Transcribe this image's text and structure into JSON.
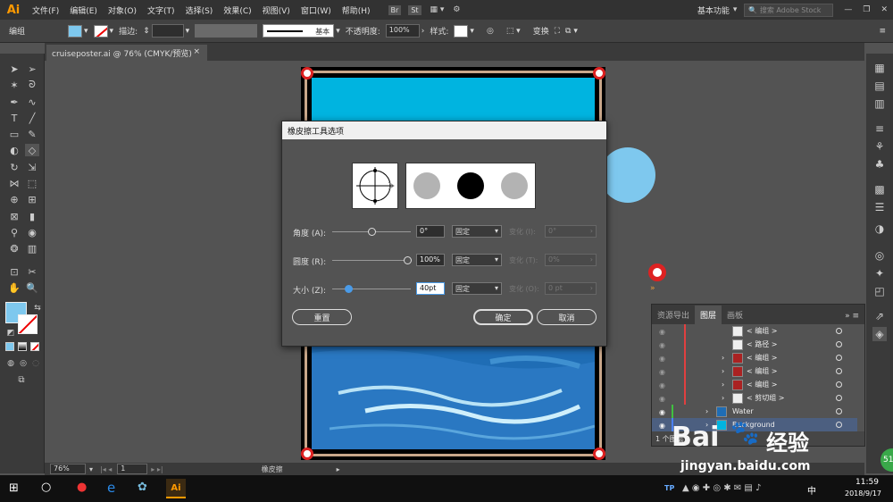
{
  "app": {
    "logo": "Ai"
  },
  "menu": [
    "文件(F)",
    "编辑(E)",
    "对象(O)",
    "文字(T)",
    "选择(S)",
    "效果(C)",
    "视图(V)",
    "窗口(W)",
    "帮助(H)"
  ],
  "menu_right": {
    "br_label": "Br",
    "st_label": "St",
    "workspace": "基本功能",
    "search_placeholder": "搜索 Adobe Stock"
  },
  "control": {
    "selection": "编组",
    "stroke_label": "描边:",
    "stroke_style": "基本",
    "opacity_label": "不透明度:",
    "opacity": "100%",
    "style_label": "样式:",
    "transform_label": "变换"
  },
  "document": {
    "tab_title": "cruiseposter.ai @ 76% (CMYK/预览)",
    "tab_close": "×"
  },
  "status": {
    "zoom": "76%",
    "page": "1",
    "tool": "橡皮擦"
  },
  "dialog": {
    "title": "橡皮擦工具选项",
    "rows": [
      {
        "label": "角度 (A):",
        "value": "0°",
        "mode": "固定",
        "var_label": "变化 (I):",
        "var_value": "0°"
      },
      {
        "label": "圆度 (R):",
        "value": "100%",
        "mode": "固定",
        "var_label": "变化 (T):",
        "var_value": "0%"
      },
      {
        "label": "大小 (Z):",
        "value": "40pt",
        "mode": "固定",
        "var_label": "变化 (O):",
        "var_value": "0 pt"
      }
    ],
    "reset": "重置",
    "ok": "确定",
    "cancel": "取消"
  },
  "layers_panel": {
    "tabs": [
      "资源导出",
      "图层",
      "画板"
    ],
    "active_tab": "图层",
    "rows": [
      {
        "name": "< 编组 >"
      },
      {
        "name": "< 路径 >"
      },
      {
        "name": "< 编组 >"
      },
      {
        "name": "< 编组 >"
      },
      {
        "name": "< 编组 >"
      },
      {
        "name": "< 剪切组 >"
      },
      {
        "name": "Water"
      },
      {
        "name": "Background"
      }
    ],
    "footer": "1 个图层"
  },
  "taskbar": {
    "time": "11:59",
    "date": "2018/9/17",
    "ime": "中",
    "tp_label": "TP",
    "ai_label": "Ai"
  },
  "watermark": {
    "brand": "Bai",
    "brand_cn": "经验",
    "url": "jingyan.baidu.com",
    "badge": "51"
  },
  "colors": {
    "accent": "#7ec8ee",
    "sky": "#00b4e0",
    "sea": "#1f6db5"
  }
}
